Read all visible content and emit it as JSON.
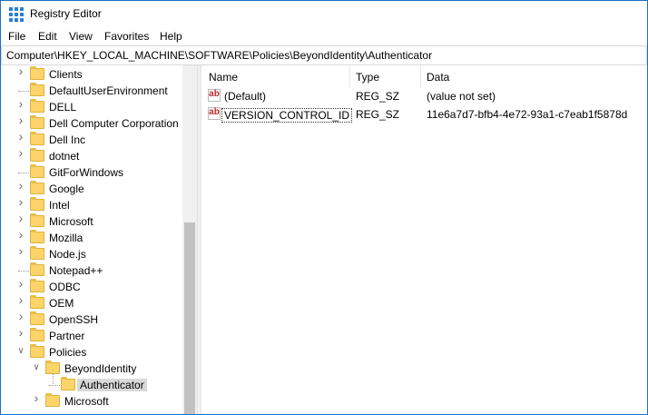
{
  "window": {
    "title": "Registry Editor",
    "icon": "registry-editor-icon"
  },
  "menu": {
    "items": [
      "File",
      "Edit",
      "View",
      "Favorites",
      "Help"
    ]
  },
  "address": {
    "path": "Computer\\HKEY_LOCAL_MACHINE\\SOFTWARE\\Policies\\BeyondIdentity\\Authenticator"
  },
  "tree": {
    "items": [
      {
        "label": "Clients",
        "expandable": true
      },
      {
        "label": "DefaultUserEnvironment",
        "expandable": false
      },
      {
        "label": "DELL",
        "expandable": true
      },
      {
        "label": "Dell Computer Corporation",
        "expandable": true
      },
      {
        "label": "Dell Inc",
        "expandable": true
      },
      {
        "label": "dotnet",
        "expandable": true
      },
      {
        "label": "GitForWindows",
        "expandable": false
      },
      {
        "label": "Google",
        "expandable": true
      },
      {
        "label": "Intel",
        "expandable": true
      },
      {
        "label": "Microsoft",
        "expandable": true
      },
      {
        "label": "Mozilla",
        "expandable": true
      },
      {
        "label": "Node.js",
        "expandable": true
      },
      {
        "label": "Notepad++",
        "expandable": false
      },
      {
        "label": "ODBC",
        "expandable": true
      },
      {
        "label": "OEM",
        "expandable": true
      },
      {
        "label": "OpenSSH",
        "expandable": true
      },
      {
        "label": "Partner",
        "expandable": true
      },
      {
        "label": "Policies",
        "expandable": true,
        "expanded": true
      },
      {
        "label": "BeyondIdentity",
        "expandable": true,
        "expanded": true
      },
      {
        "label": "Authenticator",
        "expandable": false,
        "selected": true
      },
      {
        "label": "Microsoft",
        "expandable": true
      }
    ]
  },
  "list": {
    "columns": [
      "Name",
      "Type",
      "Data"
    ],
    "rows": [
      {
        "name": "(Default)",
        "type": "REG_SZ",
        "data": "(value not set)",
        "icon": "string-value-icon"
      },
      {
        "name": "VERSION_CONTROL_ID",
        "type": "REG_SZ",
        "data": "11e6a7d7-bfb4-4e72-93a1-c7eab1f5878d",
        "icon": "string-value-icon",
        "focused": true
      }
    ]
  },
  "colors": {
    "accent": "#1c6fc7",
    "folder": "#fcd46a",
    "selection": "#d9d9d9",
    "string-icon": "#c0282d"
  }
}
